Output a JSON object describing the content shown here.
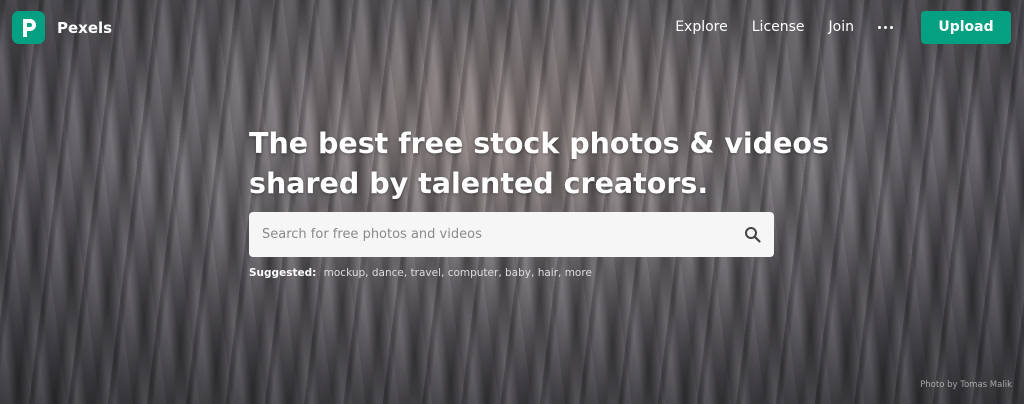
{
  "brand": {
    "name": "Pexels",
    "accent": "#05a081"
  },
  "nav": {
    "links": [
      "Explore",
      "License",
      "Join"
    ],
    "more_icon": "more-horizontal-icon",
    "upload_label": "Upload"
  },
  "hero": {
    "headline_line1": "The best free stock photos & videos",
    "headline_line2": "shared by talented creators."
  },
  "search": {
    "placeholder": "Search for free photos and videos",
    "value": "",
    "icon": "search-icon"
  },
  "suggested": {
    "label": "Suggested:",
    "tags": [
      "mockup",
      "dance",
      "travel",
      "computer",
      "baby",
      "hair",
      "more"
    ]
  },
  "credit": "Photo by Tomas Malik"
}
